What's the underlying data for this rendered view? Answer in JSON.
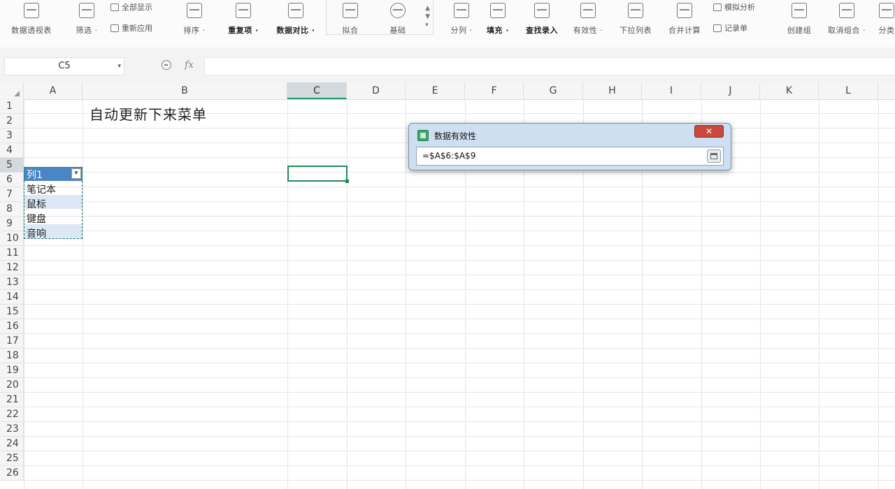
{
  "ribbon": {
    "buttons": [
      {
        "id": "pivot",
        "label": "数据透视表"
      },
      {
        "id": "filter",
        "label": "筛选 ·"
      },
      {
        "id": "sort",
        "label": "排序 ·"
      },
      {
        "id": "duplicates",
        "label": "重复项 ·"
      },
      {
        "id": "compare",
        "label": "数据对比 ·"
      },
      {
        "id": "chart1",
        "label": "拟合"
      },
      {
        "id": "chart2",
        "label": "基础"
      },
      {
        "id": "split",
        "label": "分列 ·"
      },
      {
        "id": "fill",
        "label": "填充 ·"
      },
      {
        "id": "lookup",
        "label": "查找录入"
      },
      {
        "id": "validity",
        "label": "有效性 ·"
      },
      {
        "id": "dropdown",
        "label": "下拉列表"
      },
      {
        "id": "consolidate",
        "label": "合并计算"
      },
      {
        "id": "group",
        "label": "创建组"
      },
      {
        "id": "ungroup",
        "label": "取消组合 ·"
      },
      {
        "id": "subtotal",
        "label": "分类"
      }
    ],
    "small": {
      "show_all": "全部显示",
      "reapply": "重新应用",
      "whatif": "模拟分析",
      "recorded": "记录单"
    }
  },
  "formula_bar": {
    "name_box": "C5",
    "fx": "fx",
    "value": ""
  },
  "sheet": {
    "columns": [
      "A",
      "B",
      "C",
      "D",
      "E",
      "F",
      "G",
      "H",
      "I",
      "J",
      "K",
      "L"
    ],
    "rows": [
      "1",
      "2",
      "3",
      "4",
      "5",
      "6",
      "7",
      "8",
      "9",
      "10",
      "11",
      "12",
      "13",
      "14",
      "15",
      "16",
      "17",
      "18",
      "19",
      "20",
      "21",
      "22",
      "23",
      "24",
      "25",
      "26"
    ],
    "selected_column": "C",
    "cells": {
      "B1": "自动更新下来菜单",
      "A5": "列1",
      "A6": "笔记本",
      "A7": "鼠标",
      "A8": "键盘",
      "A9": "音响"
    }
  },
  "dialog": {
    "title": "数据有效性",
    "close": "✕",
    "input": "=$A$6:$A$9"
  },
  "colors": {
    "accent_green": "#1f8a5a",
    "table_header_blue": "#4a86c5",
    "table_band": "#dce8f5",
    "close_red": "#c94a3c"
  }
}
